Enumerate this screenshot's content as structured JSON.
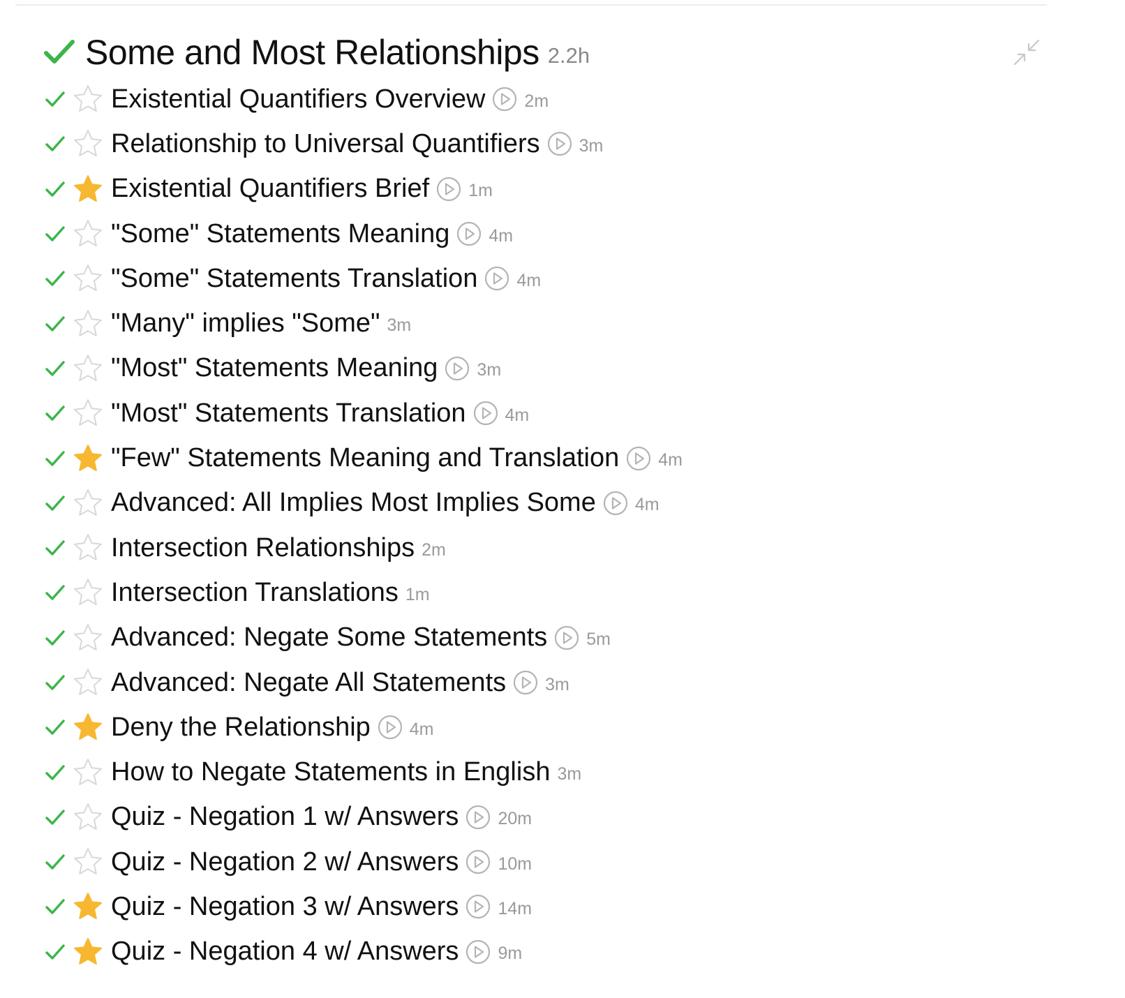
{
  "colors": {
    "check_green": "#3bb54a",
    "star_filled": "#f7b731",
    "star_outline": "#d8d8d8",
    "play_icon": "#b4b4b4",
    "duration_text": "#9a9a9a",
    "title_text": "#111111"
  },
  "section": {
    "title": "Some and Most Relationships",
    "duration": "2.2h",
    "completed": true,
    "icons": {
      "check": "check-icon",
      "collapse": "collapse-arrows-icon"
    }
  },
  "lessons": [
    {
      "title": "Existential Quantifiers Overview",
      "duration": "2m",
      "starred": false,
      "has_video": true,
      "completed": true
    },
    {
      "title": "Relationship to Universal Quantifiers",
      "duration": "3m",
      "starred": false,
      "has_video": true,
      "completed": true
    },
    {
      "title": "Existential Quantifiers Brief",
      "duration": "1m",
      "starred": true,
      "has_video": true,
      "completed": true
    },
    {
      "title": "\"Some\" Statements Meaning",
      "duration": "4m",
      "starred": false,
      "has_video": true,
      "completed": true
    },
    {
      "title": "\"Some\" Statements Translation",
      "duration": "4m",
      "starred": false,
      "has_video": true,
      "completed": true
    },
    {
      "title": "\"Many\" implies \"Some\"",
      "duration": "3m",
      "starred": false,
      "has_video": false,
      "completed": true
    },
    {
      "title": "\"Most\" Statements Meaning",
      "duration": "3m",
      "starred": false,
      "has_video": true,
      "completed": true
    },
    {
      "title": "\"Most\" Statements Translation",
      "duration": "4m",
      "starred": false,
      "has_video": true,
      "completed": true
    },
    {
      "title": "\"Few\" Statements Meaning and Translation",
      "duration": "4m",
      "starred": true,
      "has_video": true,
      "completed": true
    },
    {
      "title": "Advanced: All Implies Most Implies Some",
      "duration": "4m",
      "starred": false,
      "has_video": true,
      "completed": true
    },
    {
      "title": "Intersection Relationships",
      "duration": "2m",
      "starred": false,
      "has_video": false,
      "completed": true
    },
    {
      "title": "Intersection Translations",
      "duration": "1m",
      "starred": false,
      "has_video": false,
      "completed": true
    },
    {
      "title": "Advanced: Negate Some Statements",
      "duration": "5m",
      "starred": false,
      "has_video": true,
      "completed": true
    },
    {
      "title": "Advanced: Negate All Statements",
      "duration": "3m",
      "starred": false,
      "has_video": true,
      "completed": true
    },
    {
      "title": "Deny the Relationship",
      "duration": "4m",
      "starred": true,
      "has_video": true,
      "completed": true
    },
    {
      "title": "How to Negate Statements in English",
      "duration": "3m",
      "starred": false,
      "has_video": false,
      "completed": true
    },
    {
      "title": "Quiz - Negation 1 w/ Answers",
      "duration": "20m",
      "starred": false,
      "has_video": true,
      "completed": true
    },
    {
      "title": "Quiz - Negation 2 w/ Answers",
      "duration": "10m",
      "starred": false,
      "has_video": true,
      "completed": true
    },
    {
      "title": "Quiz - Negation 3 w/ Answers",
      "duration": "14m",
      "starred": true,
      "has_video": true,
      "completed": true
    },
    {
      "title": "Quiz - Negation 4 w/ Answers",
      "duration": "9m",
      "starred": true,
      "has_video": true,
      "completed": true
    }
  ]
}
